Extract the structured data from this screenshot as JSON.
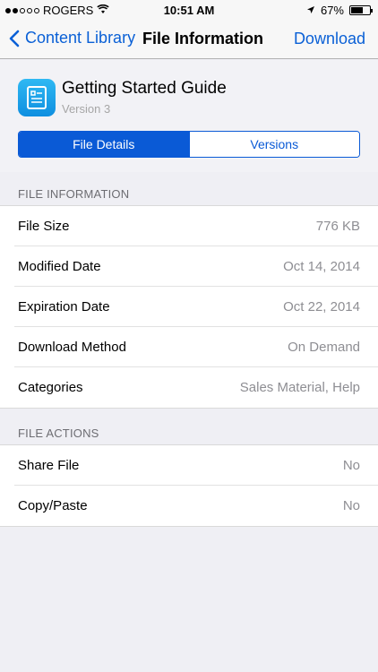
{
  "status_bar": {
    "carrier": "ROGERS",
    "time": "10:51 AM",
    "battery": "67%",
    "battery_fraction": 0.67,
    "signal_bars_filled": 2,
    "signal_bars_total": 5
  },
  "nav": {
    "back_label": "Content Library",
    "title": "File Information",
    "action_label": "Download",
    "accent_color": "#0a60d6"
  },
  "file": {
    "title": "Getting Started Guide",
    "version": "Version 3",
    "icon": "document-icon"
  },
  "segments": {
    "file_details": "File Details",
    "versions": "Versions",
    "selected": "File Details"
  },
  "file_information": {
    "header": "FILE INFORMATION",
    "rows": [
      {
        "label": "File Size",
        "value": "776 KB"
      },
      {
        "label": "Modified Date",
        "value": "Oct 14, 2014"
      },
      {
        "label": "Expiration Date",
        "value": "Oct 22, 2014"
      },
      {
        "label": "Download Method",
        "value": "On Demand"
      },
      {
        "label": "Categories",
        "value": "Sales Material, Help"
      }
    ]
  },
  "file_actions": {
    "header": "FILE ACTIONS",
    "rows": [
      {
        "label": "Share File",
        "value": "No"
      },
      {
        "label": "Copy/Paste",
        "value": "No"
      }
    ]
  }
}
